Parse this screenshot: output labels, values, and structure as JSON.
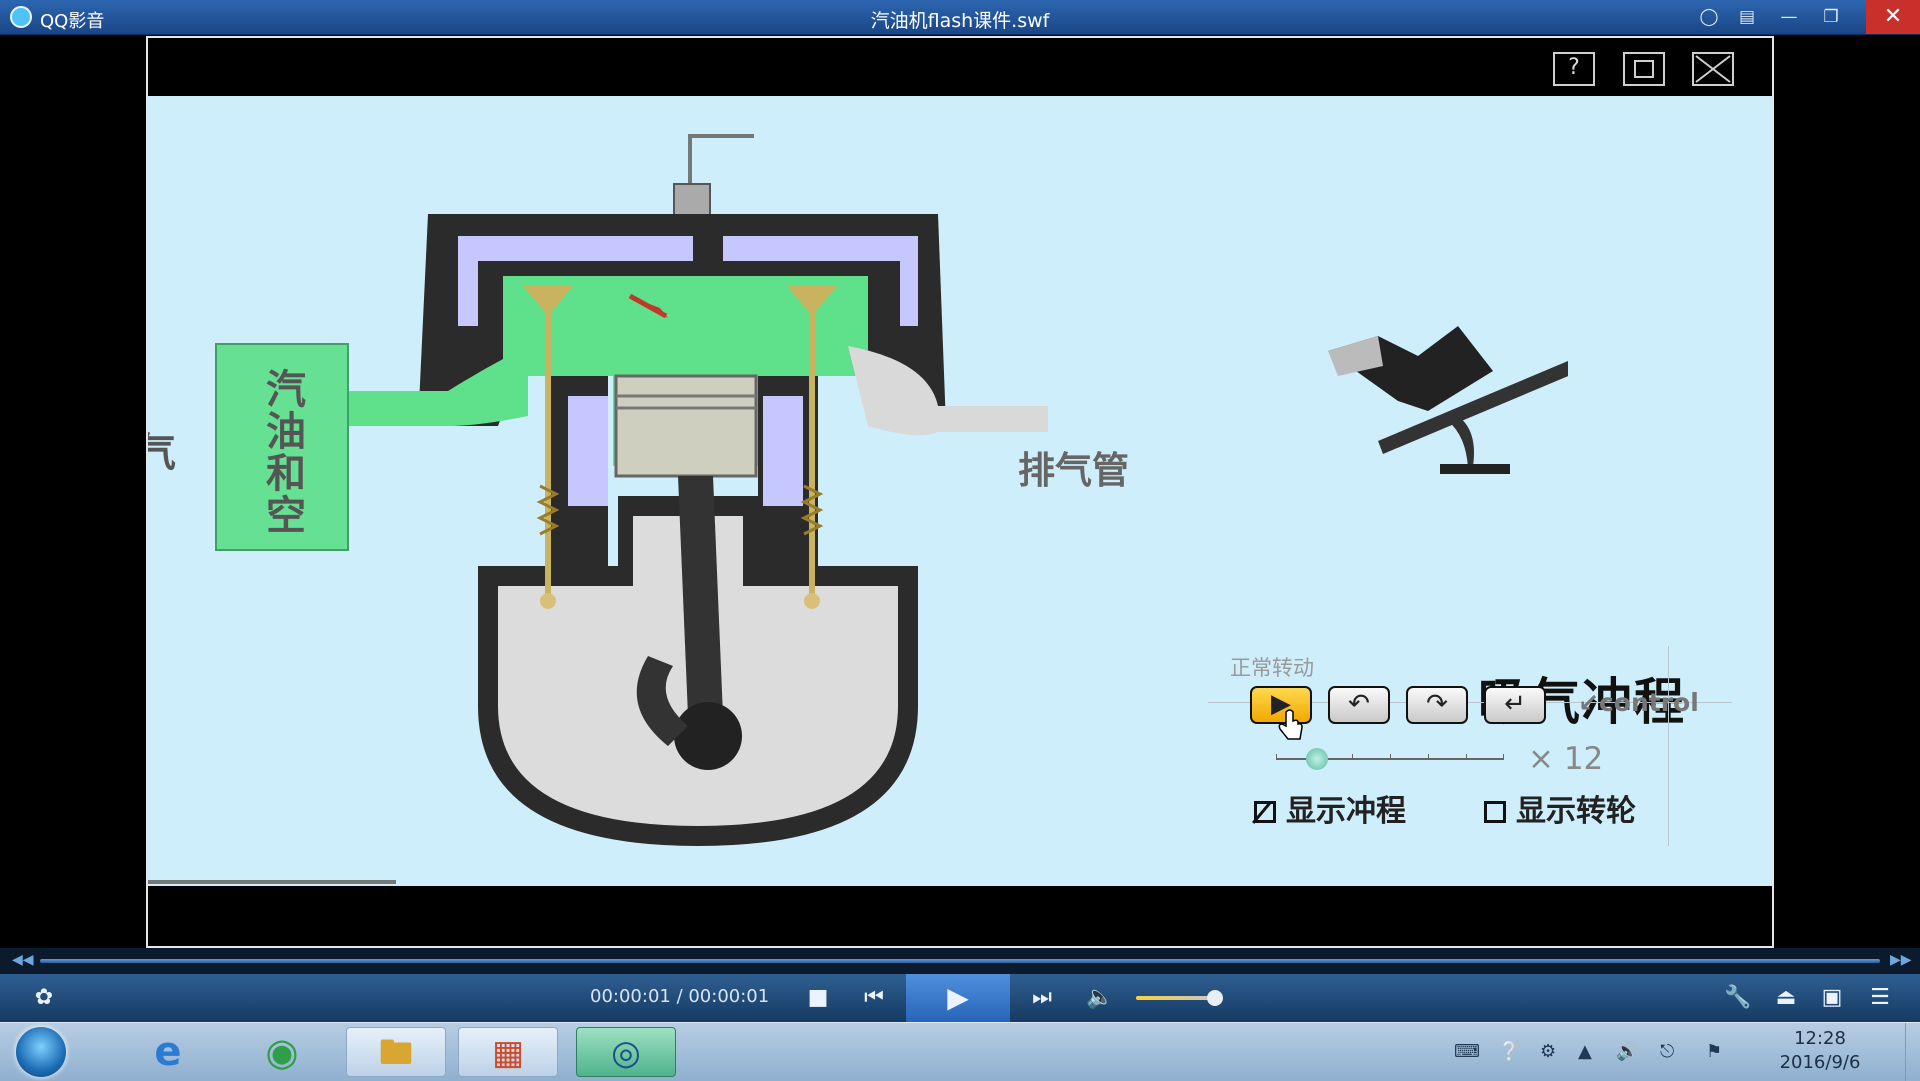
{
  "app": {
    "name": "QQ影音",
    "window_title": "汽油机flash课件.swf"
  },
  "titlebar_icons": [
    "skin-icon",
    "menu-icon",
    "minimize-icon",
    "restore-icon",
    "close-icon"
  ],
  "stage_toolbar": {
    "help_label": "?"
  },
  "animation": {
    "stroke_name": "吸气冲程",
    "exhaust_label": "排气管",
    "mixture_label": "汽油和空气",
    "mode_label": "正常转动",
    "control_label": "↙control",
    "buttons": [
      {
        "name": "play",
        "symbol": "▶"
      },
      {
        "name": "rotate-back",
        "symbol": "↶"
      },
      {
        "name": "rotate-forward",
        "symbol": "↷"
      },
      {
        "name": "reset",
        "symbol": "↵"
      }
    ],
    "speed_label": "× 12",
    "show_stroke": {
      "label": "显示冲程",
      "checked": true
    },
    "show_flywheel": {
      "label": "显示转轮",
      "checked": false
    }
  },
  "player": {
    "time": "00:00:01 / 00:00:01",
    "progress_fraction": 1.0,
    "volume_fraction": 0.85
  },
  "taskbar": {
    "clock_time": "12:28",
    "clock_date": "2016/9/6",
    "apps": [
      "ie-icon",
      "browser-icon",
      "folder-icon",
      "powerpoint-icon",
      "qqplayer-icon"
    ]
  },
  "colors": {
    "stage_bg": "#cfeefc",
    "mixture_green": "#66e092",
    "titlebar_blue": "#1f4f91",
    "play_active": "#f1b300"
  }
}
